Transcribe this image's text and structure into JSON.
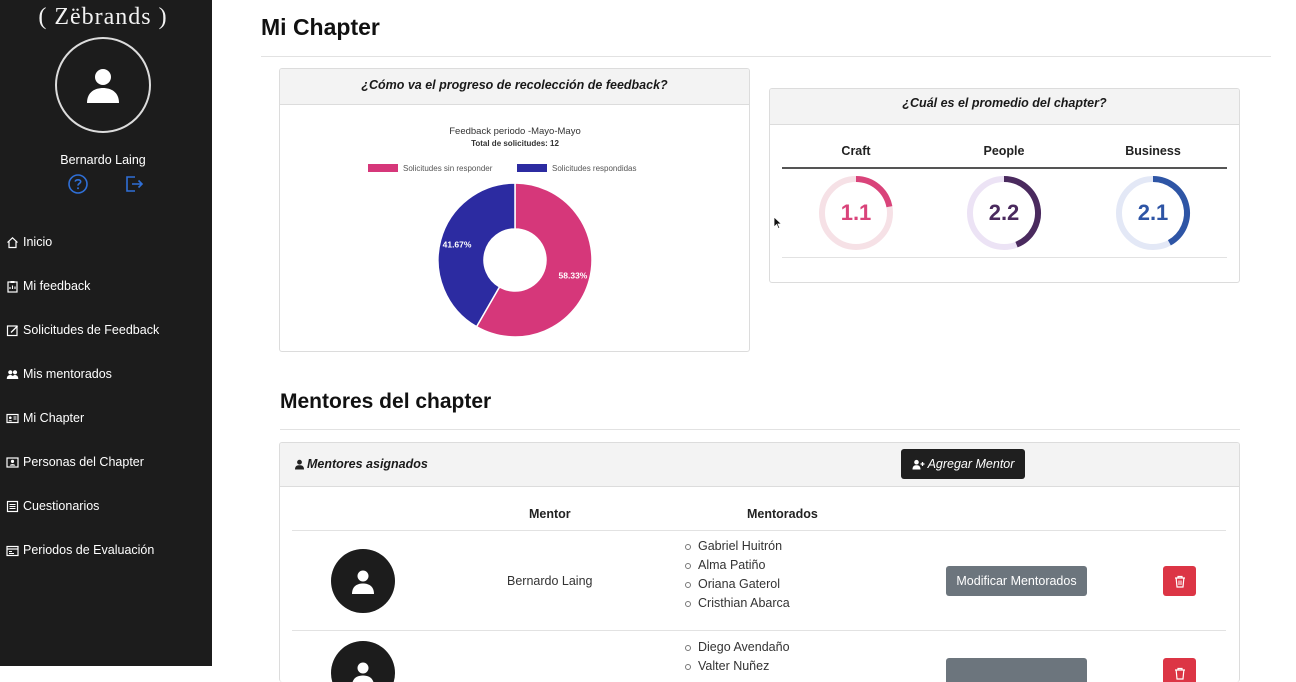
{
  "sidebar": {
    "brand": "( Zëbrands )",
    "user_name": "Bernardo Laing",
    "items": [
      {
        "label": "Inicio",
        "icon": "home-icon"
      },
      {
        "label": "Mi feedback",
        "icon": "clipboard-icon"
      },
      {
        "label": "Solicitudes de Feedback",
        "icon": "edit-icon"
      },
      {
        "label": "Mis mentorados",
        "icon": "people-icon"
      },
      {
        "label": "Mi Chapter",
        "icon": "id-card-icon"
      },
      {
        "label": "Personas del Chapter",
        "icon": "person-badge-icon"
      },
      {
        "label": "Cuestionarios",
        "icon": "list-icon"
      },
      {
        "label": "Periodos de Evaluación",
        "icon": "calendar-icon"
      }
    ]
  },
  "main": {
    "title": "Mi Chapter",
    "feedback_card": {
      "header": "¿Cómo va el progreso de recolección de feedback?"
    },
    "average_card": {
      "header": "¿Cuál es el promedio del chapter?",
      "scores": [
        {
          "label": "Craft",
          "value": "1.1",
          "fraction": 0.22,
          "color": "#d9437a",
          "track": "#f6e1e6"
        },
        {
          "label": "People",
          "value": "2.2",
          "fraction": 0.44,
          "color": "#4a2a5e",
          "track": "#ece3f5"
        },
        {
          "label": "Business",
          "value": "2.1",
          "fraction": 0.42,
          "color": "#2e55a5",
          "track": "#e3e8f6"
        }
      ]
    },
    "mentors_section": {
      "title": "Mentores del chapter",
      "header_label": "Mentores asignados",
      "add_button": "Agregar Mentor",
      "col_mentor": "Mentor",
      "col_mentorados": "Mentorados",
      "rows": [
        {
          "mentor": "Bernardo Laing",
          "mentorados": [
            "Gabriel Huitrón",
            "Alma Patiño",
            "Oriana Gaterol",
            "Cristhian Abarca"
          ],
          "modify_button": "Modificar Mentorados"
        },
        {
          "mentor": "",
          "mentorados": [
            "Diego Avendaño",
            "Valter Nuñez"
          ],
          "modify_button": ""
        }
      ]
    }
  },
  "chart_data": {
    "type": "pie",
    "title": "Feedback periodo -Mayo-Mayo",
    "subtitle": "Total de solicitudes: 12",
    "series": [
      {
        "name": "Solicitudes sin responder",
        "value": 58.33,
        "label": "58.33%",
        "color": "#d6377a"
      },
      {
        "name": "Solicitudes respondidas",
        "value": 41.67,
        "label": "41.67%",
        "color": "#2c2ba1"
      }
    ],
    "legend_position": "top"
  }
}
